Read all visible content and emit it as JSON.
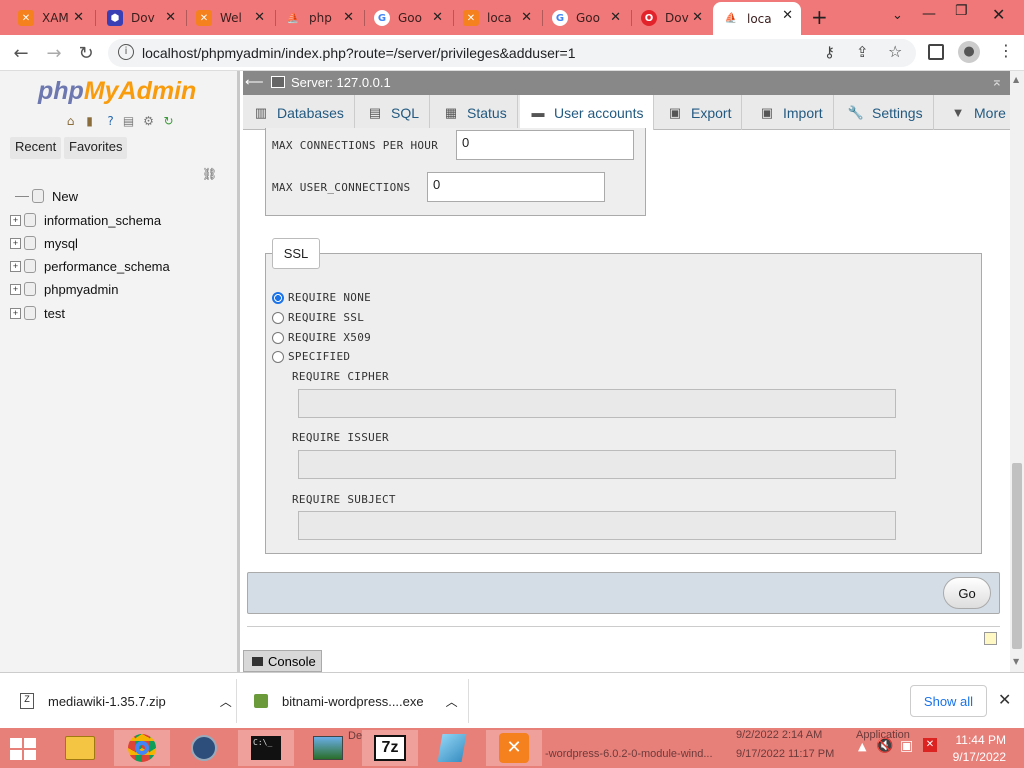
{
  "browser": {
    "tabs": [
      {
        "label": "XAM",
        "fav_color": "#f4801e",
        "fav": "✕"
      },
      {
        "label": "Dov",
        "fav_color": "#3b3fb5",
        "fav": "⬢"
      },
      {
        "label": "Wel",
        "fav_color": "#f4801e",
        "fav": "✕"
      },
      {
        "label": "php",
        "fav_color": "#f39c3a",
        "fav": "⛵"
      },
      {
        "label": "Goo",
        "fav_color": "#ffffff",
        "fav": "G"
      },
      {
        "label": "loca",
        "fav_color": "#f4801e",
        "fav": "✕"
      },
      {
        "label": "Goo",
        "fav_color": "#ffffff",
        "fav": "G"
      },
      {
        "label": "Dov",
        "fav_color": "#e3232b",
        "fav": "O"
      },
      {
        "label": "loca",
        "fav_color": "#f39c3a",
        "fav": "⛵"
      }
    ],
    "new_tab": "+",
    "url": "localhost/phpmyadmin/index.php?route=/server/privileges&adduser=1"
  },
  "pma": {
    "logo_a": "php",
    "logo_b": "MyAdmin",
    "recent": "Recent",
    "favorites": "Favorites",
    "tree": [
      "New",
      "information_schema",
      "mysql",
      "performance_schema",
      "phpmyadmin",
      "test"
    ],
    "server": "Server: 127.0.0.1",
    "tabs": [
      "Databases",
      "SQL",
      "Status",
      "User accounts",
      "Export",
      "Import",
      "Settings",
      "More"
    ],
    "max_conn_label": "MAX CONNECTIONS PER HOUR",
    "max_conn_value": "0",
    "max_user_label": "MAX USER_CONNECTIONS",
    "max_user_value": "0",
    "ssl_legend": "SSL",
    "ssl_options": [
      "REQUIRE NONE",
      "REQUIRE SSL",
      "REQUIRE X509",
      "SPECIFIED"
    ],
    "cipher_label": "REQUIRE CIPHER",
    "issuer_label": "REQUIRE ISSUER",
    "subject_label": "REQUIRE SUBJECT",
    "go": "Go",
    "console": "Console"
  },
  "downloads": {
    "items": [
      "mediawiki-1.35.7.zip",
      "bitnami-wordpress....exe"
    ],
    "show_all": "Show all"
  },
  "taskbar": {
    "ghost1": "Desktop",
    "ghost2": "9/2/2022 2:14 AM",
    "ghost3": "Application",
    "ghost4": "-wordpress-6.0.2-0-module-wind...",
    "ghost5": "9/17/2022 11:17 PM",
    "time": "11:44 PM",
    "date": "9/17/2022"
  }
}
